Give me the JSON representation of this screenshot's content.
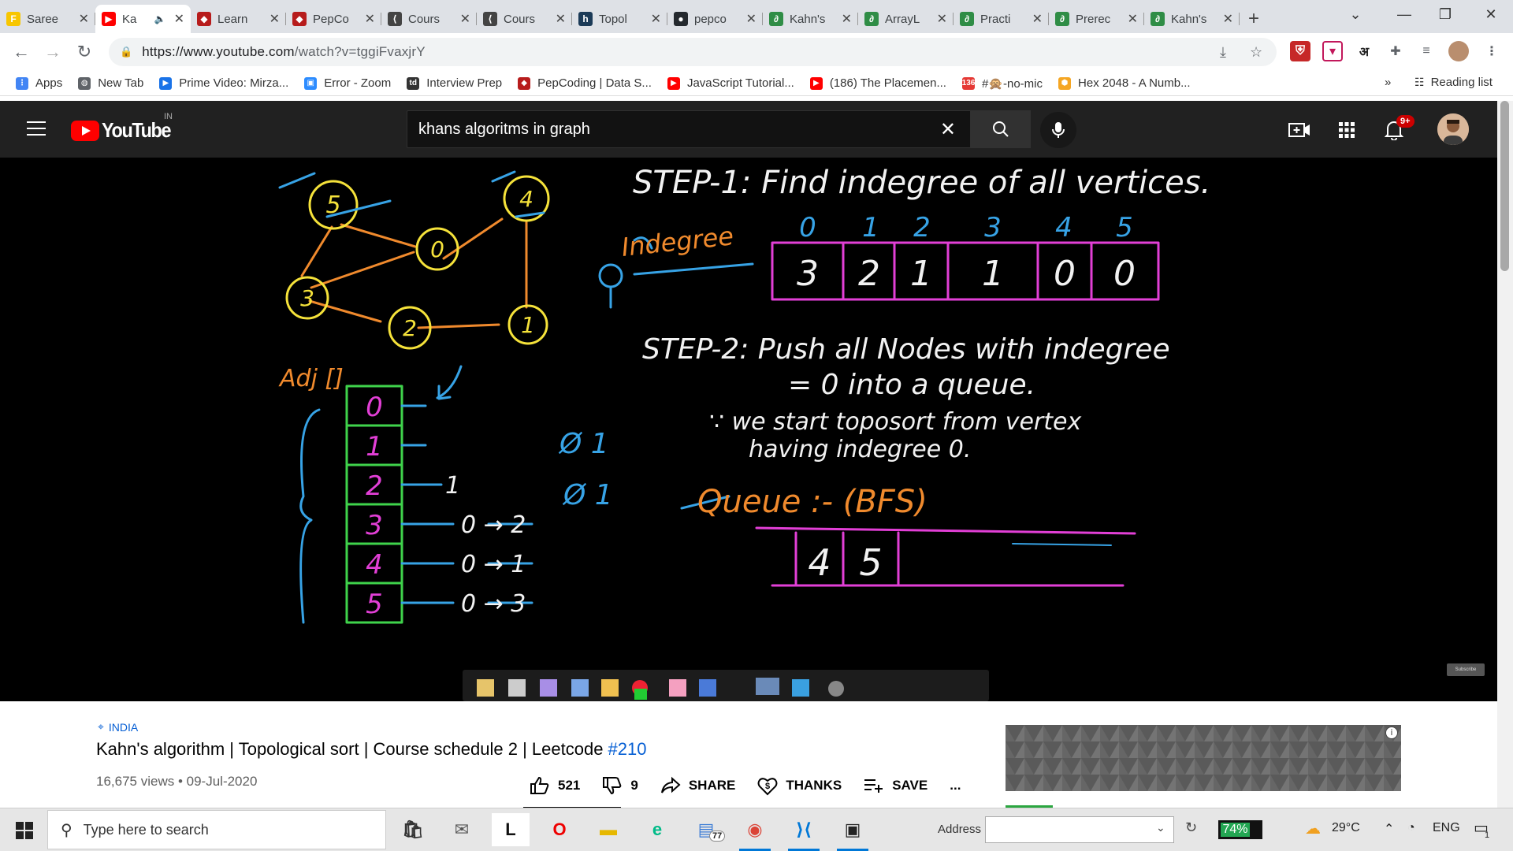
{
  "browser": {
    "tabs": [
      {
        "label": "Saree",
        "icon": "flipkart-icon",
        "color": "#f7c600",
        "glyph": "F"
      },
      {
        "label": "Ka",
        "icon": "youtube-icon",
        "color": "#ff0000",
        "glyph": "▶",
        "active": true,
        "audio": "🔈"
      },
      {
        "label": "Learn",
        "icon": "pepcoding-icon",
        "color": "#b71c1c",
        "glyph": "◆"
      },
      {
        "label": "PepCo",
        "icon": "pepcoding-icon",
        "color": "#b71c1c",
        "glyph": "◆"
      },
      {
        "label": "Cours",
        "icon": "leetcode-icon",
        "color": "#444444",
        "glyph": "⟨"
      },
      {
        "label": "Cours",
        "icon": "leetcode-icon",
        "color": "#444444",
        "glyph": "⟨"
      },
      {
        "label": "Topol",
        "icon": "hackerrank-icon",
        "color": "#1b3a57",
        "glyph": "h"
      },
      {
        "label": "pepco",
        "icon": "github-icon",
        "color": "#24292e",
        "glyph": "●"
      },
      {
        "label": "Kahn's",
        "icon": "gfg-icon",
        "color": "#2f8d46",
        "glyph": "∂"
      },
      {
        "label": "ArrayL",
        "icon": "gfg-icon",
        "color": "#2f8d46",
        "glyph": "∂"
      },
      {
        "label": "Practi",
        "icon": "gfg-icon",
        "color": "#2f8d46",
        "glyph": "∂"
      },
      {
        "label": "Prerec",
        "icon": "gfg-icon",
        "color": "#2f8d46",
        "glyph": "∂"
      },
      {
        "label": "Kahn's",
        "icon": "gfg-icon",
        "color": "#2f8d46",
        "glyph": "∂"
      }
    ],
    "url_host": "https://www.youtube.com",
    "url_path": "/watch?v=tggiFvaxjrY",
    "bookmarks": [
      {
        "label": "Apps",
        "color": "#4285f4",
        "glyph": "⋮"
      },
      {
        "label": "New Tab",
        "color": "#5f6368",
        "glyph": "◍"
      },
      {
        "label": "Prime Video: Mirza...",
        "color": "#1a73e8",
        "glyph": "▶"
      },
      {
        "label": "Error - Zoom",
        "color": "#2d8cff",
        "glyph": "▣"
      },
      {
        "label": "Interview Prep",
        "color": "#333333",
        "glyph": "td"
      },
      {
        "label": "PepCoding | Data S...",
        "color": "#b71c1c",
        "glyph": "◆"
      },
      {
        "label": "JavaScript Tutorial...",
        "color": "#ff0000",
        "glyph": "▶"
      },
      {
        "label": "(186) The Placemen...",
        "color": "#ff0000",
        "glyph": "▶"
      },
      {
        "label": "#🙊-no-mic",
        "color": "#e53935",
        "glyph": "136"
      },
      {
        "label": "Hex 2048 - A Numb...",
        "color": "#f5a623",
        "glyph": "⬢"
      }
    ],
    "bookmarks_overflow": "»",
    "reading_list": "Reading list"
  },
  "youtube": {
    "region": "IN",
    "search_query": "khans algoritms in graph",
    "notification_count": "9+"
  },
  "video": {
    "location": "INDIA",
    "title": "Kahn's algorithm | Topological sort | Course schedule 2 | Leetcode ",
    "hashtag": "#210",
    "views": "16,675 views",
    "date": "09-Jul-2020",
    "likes": "521",
    "dislikes": "9",
    "share": "SHARE",
    "thanks": "THANKS",
    "save": "SAVE",
    "more": "...",
    "subscribe_btn": "Subscribe",
    "board": {
      "step1": "STEP-1: Find indegree of all vertices.",
      "indegree_label": "Indegree",
      "indices": [
        "0",
        "1",
        "2",
        "3",
        "4",
        "5"
      ],
      "indegree_values": [
        "3",
        "2",
        "1",
        "1",
        "0",
        "0"
      ],
      "step2a": "STEP-2: Push all Nodes with indegree",
      "step2b": "= 0  into a queue.",
      "because_a": "∵ we start toposort from vertex",
      "because_b": "having indegree 0.",
      "queue_label": "Queue :- (BFS)",
      "queue_values": [
        "4",
        "5"
      ],
      "adj_label": "Adj []",
      "adj_rows": [
        "0",
        "1",
        "2",
        "3",
        "4",
        "5"
      ],
      "adj_lists": [
        "",
        "",
        "1",
        "0 → 2",
        "0 → 1",
        "0 → 3"
      ],
      "graph_nodes": [
        "5",
        "4",
        "0",
        "3",
        "2",
        "1"
      ],
      "side_marks": [
        "Ø 1",
        "Ø 1"
      ]
    }
  },
  "taskbar": {
    "search_placeholder": "Type here to search",
    "address_label": "Address",
    "battery": "74%",
    "weather": "29°C",
    "lang": "ENG",
    "notif": "1",
    "badge77": "77"
  }
}
